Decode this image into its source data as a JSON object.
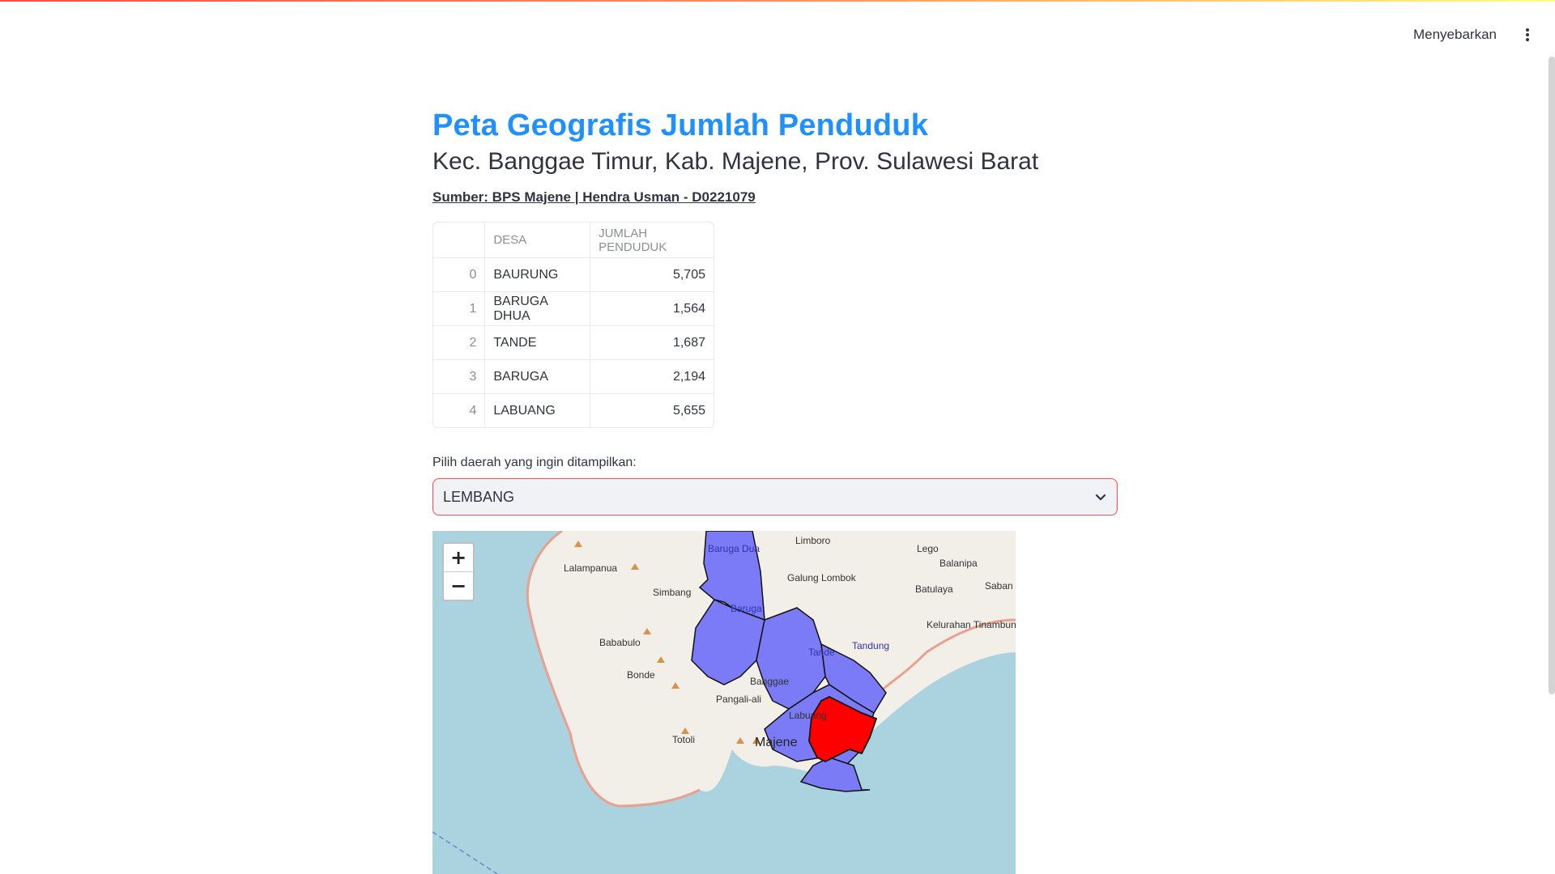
{
  "header": {
    "deploy_label": "Menyebarkan",
    "menu_icon": "vertical-ellipsis-icon"
  },
  "main": {
    "title": "Peta Geografis Jumlah Penduduk",
    "subtitle": "Kec. Banggae Timur, Kab. Majene, Prov. Sulawesi Barat",
    "source": "Sumber: BPS Majene | Hendra Usman - D0221079"
  },
  "table": {
    "columns": [
      "",
      "DESA",
      "JUMLAH PENDUDUK"
    ],
    "rows": [
      {
        "index": "0",
        "desa": "BAURUNG",
        "jumlah": "5,705"
      },
      {
        "index": "1",
        "desa": "BARUGA DHUA",
        "jumlah": "1,564"
      },
      {
        "index": "2",
        "desa": "TANDE",
        "jumlah": "1,687"
      },
      {
        "index": "3",
        "desa": "BARUGA",
        "jumlah": "2,194"
      },
      {
        "index": "4",
        "desa": "LABUANG",
        "jumlah": "5,655"
      }
    ]
  },
  "select": {
    "label": "Pilih daerah yang ingin ditampilkan:",
    "value": "LEMBANG"
  },
  "map": {
    "zoom_in": "+",
    "zoom_out": "−",
    "places": {
      "baruga_dua": "Baruga Dua",
      "limboro": "Limboro",
      "lego": "Lego",
      "balanipa": "Balanipa",
      "lalampanua": "Lalampanua",
      "galung_lombok": "Galung Lombok",
      "batulaya": "Batulaya",
      "saban": "Saban",
      "simbang": "Simbang",
      "baruga": "Baruga",
      "kelurahan_tinambung": "Kelurahan Tinambung",
      "bababulo": "Bababulo",
      "tande": "Tande",
      "tandung": "Tandung",
      "bonde": "Bonde",
      "banggae": "Banggae",
      "pangali_ali": "Pangali-ali",
      "labuang": "Labuang",
      "totoli": "Totoli",
      "majene": "Majene"
    },
    "colors": {
      "highlight": "#ff0000",
      "regions": "#7b7bf7",
      "water": "#aad3df",
      "land": "#f2efe9"
    }
  }
}
